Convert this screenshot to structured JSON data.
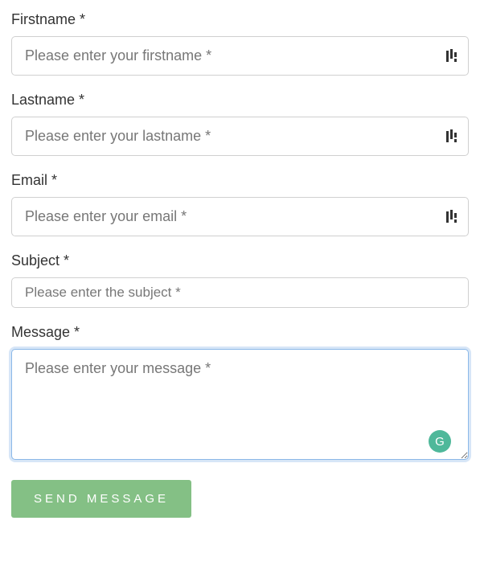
{
  "fields": {
    "firstname": {
      "label": "Firstname *",
      "placeholder": "Please enter your firstname *"
    },
    "lastname": {
      "label": "Lastname *",
      "placeholder": "Please enter your lastname *"
    },
    "email": {
      "label": "Email *",
      "placeholder": "Please enter your email *"
    },
    "subject": {
      "label": "Subject *",
      "placeholder": "Please enter the subject *"
    },
    "message": {
      "label": "Message *",
      "placeholder": "Please enter your message *"
    }
  },
  "button": {
    "submit_label": "SEND MESSAGE"
  },
  "grammarly": {
    "letter": "G"
  }
}
